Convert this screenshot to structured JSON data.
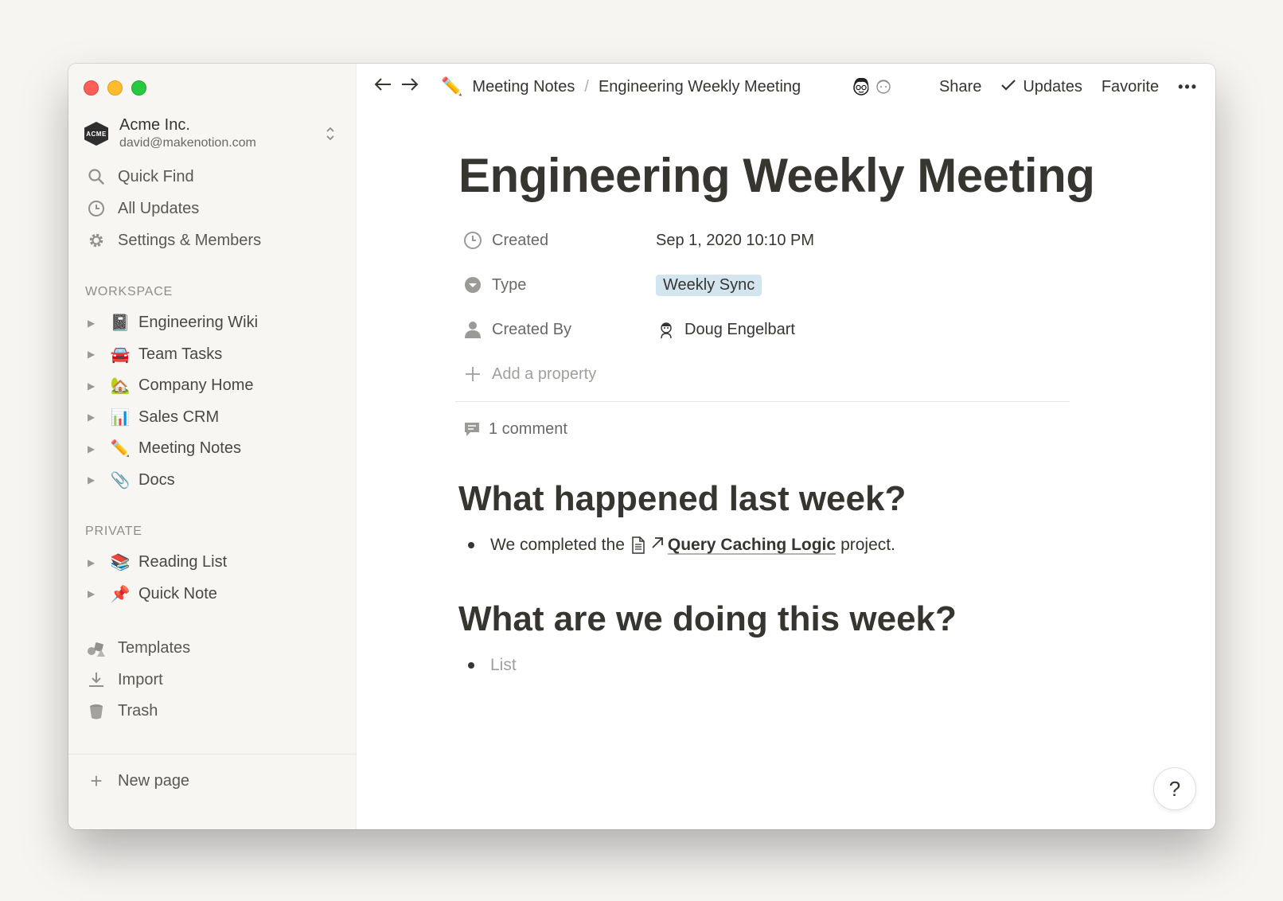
{
  "colors": {
    "sidebar_bg": "#f7f6f3",
    "tag_bg": "#d3e5ef",
    "text": "#37352f",
    "muted": "#6b6965"
  },
  "workspace": {
    "logo_text": "ACME",
    "name": "Acme Inc.",
    "email": "david@makenotion.com"
  },
  "menu": [
    {
      "label": "Quick Find",
      "icon": "search-icon"
    },
    {
      "label": "All Updates",
      "icon": "clock-icon"
    },
    {
      "label": "Settings & Members",
      "icon": "gear-icon"
    }
  ],
  "sections": {
    "workspace": {
      "label": "WORKSPACE",
      "items": [
        {
          "label": "Engineering Wiki",
          "emoji": "📓"
        },
        {
          "label": "Team Tasks",
          "emoji": "🚘"
        },
        {
          "label": "Company Home",
          "emoji": "🏡"
        },
        {
          "label": "Sales CRM",
          "emoji": "📊"
        },
        {
          "label": "Meeting Notes",
          "emoji": "✏️"
        },
        {
          "label": "Docs",
          "emoji": "📎"
        }
      ]
    },
    "private": {
      "label": "PRIVATE",
      "items": [
        {
          "label": "Reading List",
          "emoji": "📚"
        },
        {
          "label": "Quick Note",
          "emoji": "📌"
        }
      ]
    }
  },
  "bottom_menu": [
    {
      "label": "Templates",
      "icon": "templates-icon"
    },
    {
      "label": "Import",
      "icon": "import-icon"
    },
    {
      "label": "Trash",
      "icon": "trash-icon"
    }
  ],
  "new_page": {
    "label": "New page"
  },
  "topbar": {
    "breadcrumb": [
      {
        "label": "Meeting Notes",
        "emoji": "✏️"
      },
      {
        "label": "Engineering Weekly Meeting"
      }
    ],
    "separator": "/",
    "share": "Share",
    "updates": "Updates",
    "favorite": "Favorite",
    "more": "•••"
  },
  "page": {
    "title": "Engineering Weekly Meeting",
    "properties": [
      {
        "name": "Created",
        "icon": "clock-icon",
        "value": "Sep 1, 2020 10:10 PM"
      },
      {
        "name": "Type",
        "icon": "select-icon",
        "value": "Weekly Sync"
      },
      {
        "name": "Created By",
        "icon": "person-icon",
        "value": "Doug Engelbart"
      }
    ],
    "add_property": "Add a property",
    "comments": "1 comment",
    "heading_last": "What happened last week?",
    "last_week": {
      "prefix": "We completed the",
      "link": "Query Caching Logic",
      "suffix": "project."
    },
    "heading_this": "What are we doing this week?",
    "this_week_placeholder": "List"
  },
  "help": "?"
}
